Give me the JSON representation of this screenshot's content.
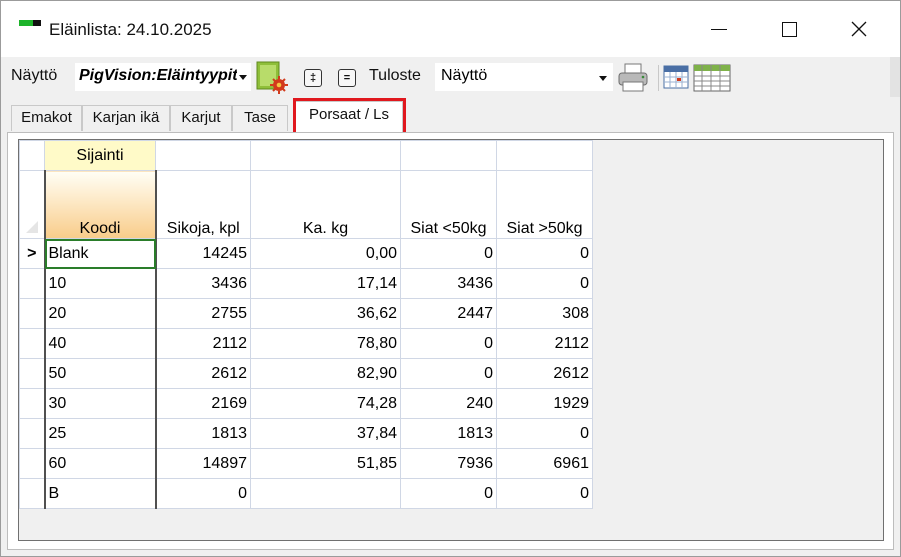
{
  "window": {
    "title": "Eläinlista: 24.10.2025"
  },
  "toolbar": {
    "view_label": "Näyttö",
    "view_value": "PigVision:Eläintyypit",
    "expand_symbol": "‡",
    "collapse_symbol": "=",
    "print_label": "Tuloste",
    "print_value": "Näyttö"
  },
  "tabs": [
    {
      "label": "Emakot"
    },
    {
      "label": "Karjan ikä"
    },
    {
      "label": "Karjut"
    },
    {
      "label": "Tase"
    },
    {
      "label": "Porsaat / Ls"
    }
  ],
  "colors": {
    "highlight": "#e0181e",
    "group_header": "#fffac8",
    "sort_header": "#f8cc8a",
    "current_cell": "#2a7d2a"
  },
  "grid": {
    "group_header": "Sijainti",
    "current_row_marker": ">",
    "columns": [
      "Koodi",
      "Sikoja, kpl",
      "Ka. kg",
      "Siat <50kg",
      "Siat >50kg"
    ],
    "rows": [
      [
        "Blank",
        "14245",
        "0,00",
        "0",
        "0"
      ],
      [
        "10",
        "3436",
        "17,14",
        "3436",
        "0"
      ],
      [
        "20",
        "2755",
        "36,62",
        "2447",
        "308"
      ],
      [
        "40",
        "2112",
        "78,80",
        "0",
        "2112"
      ],
      [
        "50",
        "2612",
        "82,90",
        "0",
        "2612"
      ],
      [
        "30",
        "2169",
        "74,28",
        "240",
        "1929"
      ],
      [
        "25",
        "1813",
        "37,84",
        "1813",
        "0"
      ],
      [
        "60",
        "14897",
        "51,85",
        "7936",
        "6961"
      ],
      [
        "B",
        "0",
        "",
        "0",
        "0"
      ]
    ]
  }
}
